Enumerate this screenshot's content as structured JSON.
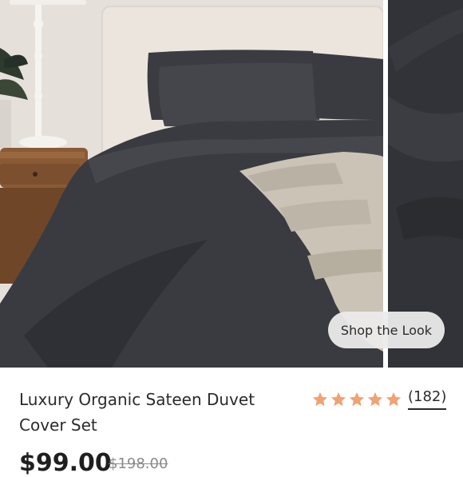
{
  "gallery": {
    "shop_button_label": "Shop the Look"
  },
  "product": {
    "title": "Luxury Organic Sateen Duvet Cover Set",
    "rating_stars": 5,
    "review_count": "(182)",
    "price": "$99.00",
    "original_price": "$198.00"
  },
  "colors": {
    "star": "#F0A274",
    "text": "#2b2b2b",
    "duvet": "#3a3b40"
  }
}
